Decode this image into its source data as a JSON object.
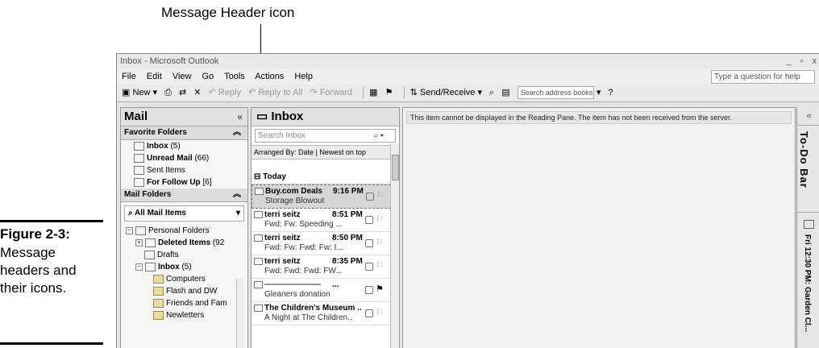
{
  "callout": "Message Header icon",
  "figure": {
    "number": "Figure 2-3:",
    "lines": [
      "Message",
      "headers and",
      "their icons."
    ]
  },
  "window": {
    "title": "Inbox - Microsoft Outlook",
    "controls": "_ ▫ x"
  },
  "menu": [
    "File",
    "Edit",
    "View",
    "Go",
    "Tools",
    "Actions",
    "Help"
  ],
  "help_placeholder": "Type a question for help",
  "toolbar": {
    "new": "New",
    "reply": "Reply",
    "reply_all": "Reply to All",
    "forward": "Forward",
    "send_receive": "Send/Receive",
    "search_placeholder": "Search address books"
  },
  "nav": {
    "title": "Mail",
    "favorites_header": "Favorite Folders",
    "favorites": [
      {
        "name": "Inbox",
        "count": "(5)"
      },
      {
        "name": "Unread Mail",
        "count": "(66)"
      },
      {
        "name": "Sent Items",
        "count": ""
      },
      {
        "name": "For Follow Up",
        "count": "[6]"
      }
    ],
    "mail_folders_header": "Mail Folders",
    "all_items": "All Mail Items",
    "tree": [
      {
        "name": "Personal Folders",
        "count": ""
      },
      {
        "name": "Deleted Items",
        "count": "(92"
      },
      {
        "name": "Drafts",
        "count": ""
      },
      {
        "name": "Inbox",
        "count": "(5)"
      },
      {
        "name": "Computers",
        "count": ""
      },
      {
        "name": "Flash and DW",
        "count": ""
      },
      {
        "name": "Friends and Fam",
        "count": ""
      },
      {
        "name": "Newletters",
        "count": ""
      }
    ]
  },
  "list": {
    "title": "Inbox",
    "search_placeholder": "Search Inbox",
    "arranged_by": "Arranged By: Date",
    "sort_order": "Newest on top",
    "group": "Today",
    "messages": [
      {
        "from": "Buy.com Deals",
        "time": "9:16 PM",
        "subject": "Storage Blowout"
      },
      {
        "from": "terri seitz",
        "time": "8:51 PM",
        "subject": "Fwd: Fw: Speeding ..."
      },
      {
        "from": "terri seitz",
        "time": "8:50 PM",
        "subject": "Fwd: Fw: Fwd: Fw: I..."
      },
      {
        "from": "terri seitz",
        "time": "8:35 PM",
        "subject": "Fwd: Fwd: Fwd: FW..."
      },
      {
        "from": "",
        "time": "...",
        "subject": "Gleaners donation"
      },
      {
        "from": "The Children's Museum ..",
        "time": "",
        "subject": "A Night at The Children..."
      }
    ]
  },
  "reading_pane": "This item cannot be displayed in the Reading Pane. The item has not been received from the server.",
  "todo": {
    "title": "To-Do Bar",
    "appointment": "Fri 12:30 PM: Garden Cl..."
  }
}
